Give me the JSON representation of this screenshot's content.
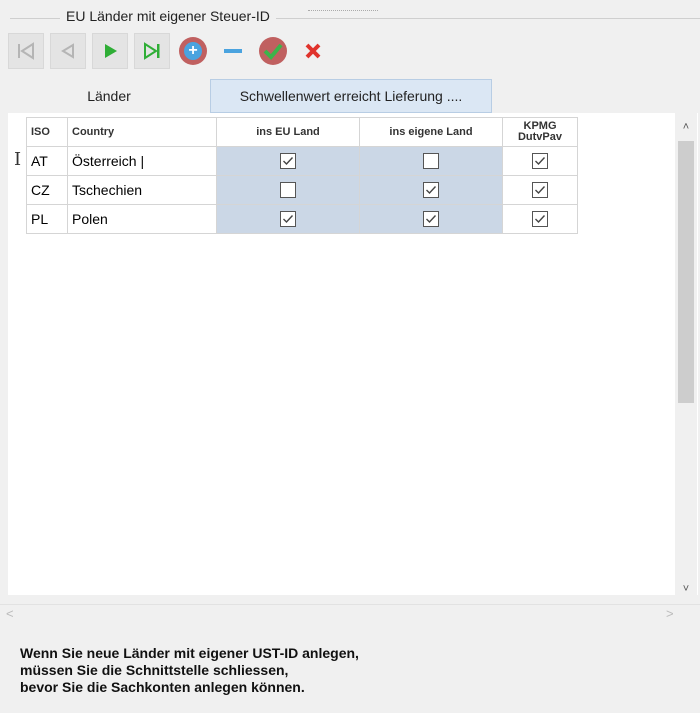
{
  "group": {
    "title": "EU Länder mit eigener Steuer-ID"
  },
  "toolbar": {
    "buttons": [
      {
        "name": "first-record",
        "icon": "first-icon"
      },
      {
        "name": "previous-record",
        "icon": "prev-icon"
      },
      {
        "name": "next-record",
        "icon": "next-icon"
      },
      {
        "name": "last-record",
        "icon": "last-icon"
      },
      {
        "name": "add-record",
        "icon": "plus-icon"
      },
      {
        "name": "delete-record",
        "icon": "minus-icon"
      },
      {
        "name": "post-record",
        "icon": "check-icon"
      },
      {
        "name": "cancel-record",
        "icon": "x-icon"
      }
    ],
    "colors": {
      "nav_gray": "#b5b5b5",
      "nav_green": "#2fae36",
      "add_bg": "#c06060",
      "add_blue": "#4aa3df",
      "check_green": "#3cb44a",
      "cancel_red": "#e0332c"
    }
  },
  "tabs": [
    {
      "label": "Länder"
    },
    {
      "label": "Schwellenwert erreicht Lieferung ...."
    }
  ],
  "grid": {
    "headers": {
      "iso": "ISO",
      "country": "Country",
      "eu": "ins EU Land",
      "own": "ins eigene Land",
      "kpmg": "KPMG DutvPav"
    },
    "rows": [
      {
        "iso": "AT",
        "country": "Österreich |",
        "eu": true,
        "own": false,
        "kpmg": true
      },
      {
        "iso": "CZ",
        "country": "Tschechien",
        "eu": false,
        "own": true,
        "kpmg": true
      },
      {
        "iso": "PL",
        "country": "Polen",
        "eu": true,
        "own": true,
        "kpmg": true
      }
    ]
  },
  "message": {
    "lines": [
      "Wenn Sie neue  Länder mit eigener UST-ID anlegen,",
      "müssen Sie die Schnittstelle schliessen,",
      "bevor Sie die Sachkonten anlegen können."
    ]
  }
}
